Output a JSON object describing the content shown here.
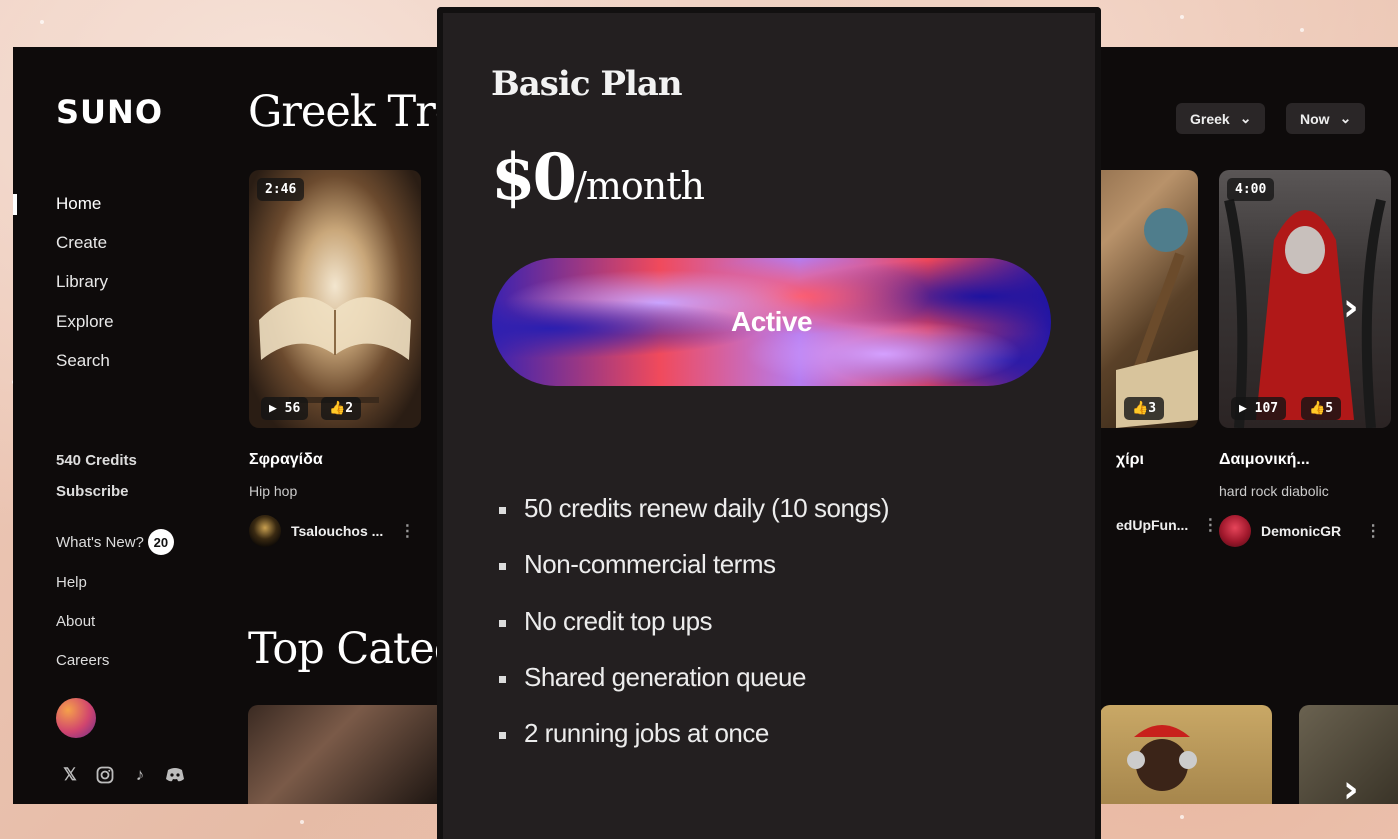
{
  "sidebar": {
    "logo": "SUNO",
    "nav": [
      "Home",
      "Create",
      "Library",
      "Explore",
      "Search"
    ],
    "credits": "540 Credits",
    "subscribe": "Subscribe",
    "whats_new": "What's New?",
    "whats_new_count": "20",
    "help": "Help",
    "about": "About",
    "careers": "Careers",
    "socials": [
      "x-icon",
      "instagram-icon",
      "tiktok-icon",
      "discord-icon"
    ]
  },
  "main": {
    "trending_title": "Greek Tren",
    "categories_title": "Top Categor",
    "filters": {
      "language": "Greek",
      "time": "Now"
    },
    "cards": [
      {
        "duration": "2:46",
        "plays": "56",
        "likes": "2",
        "title": "Σφραγίδα",
        "genre": "Hip hop",
        "author": "Tsalouchos ..."
      },
      {
        "likes": "3",
        "title": "χίρι",
        "author": "edUpFun..."
      },
      {
        "duration": "4:00",
        "plays": "107",
        "likes": "5",
        "title": "Δαιμονική...",
        "genre": "hard rock diabolic",
        "author": "DemonicGR"
      }
    ]
  },
  "modal": {
    "plan_name": "Basic Plan",
    "price_amount": "$0",
    "price_period": "/month",
    "button_label": "Active",
    "features": [
      "50 credits renew daily (10 songs)",
      "Non-commercial terms",
      "No credit top ups",
      "Shared generation queue",
      "2 running jobs at once"
    ]
  },
  "colors": {
    "app_bg": "#0e0b0b",
    "modal_bg": "#231f20",
    "accent_blue": "#2b1fb0",
    "accent_red": "#f04a5c",
    "accent_violet": "#c9a4ff"
  }
}
